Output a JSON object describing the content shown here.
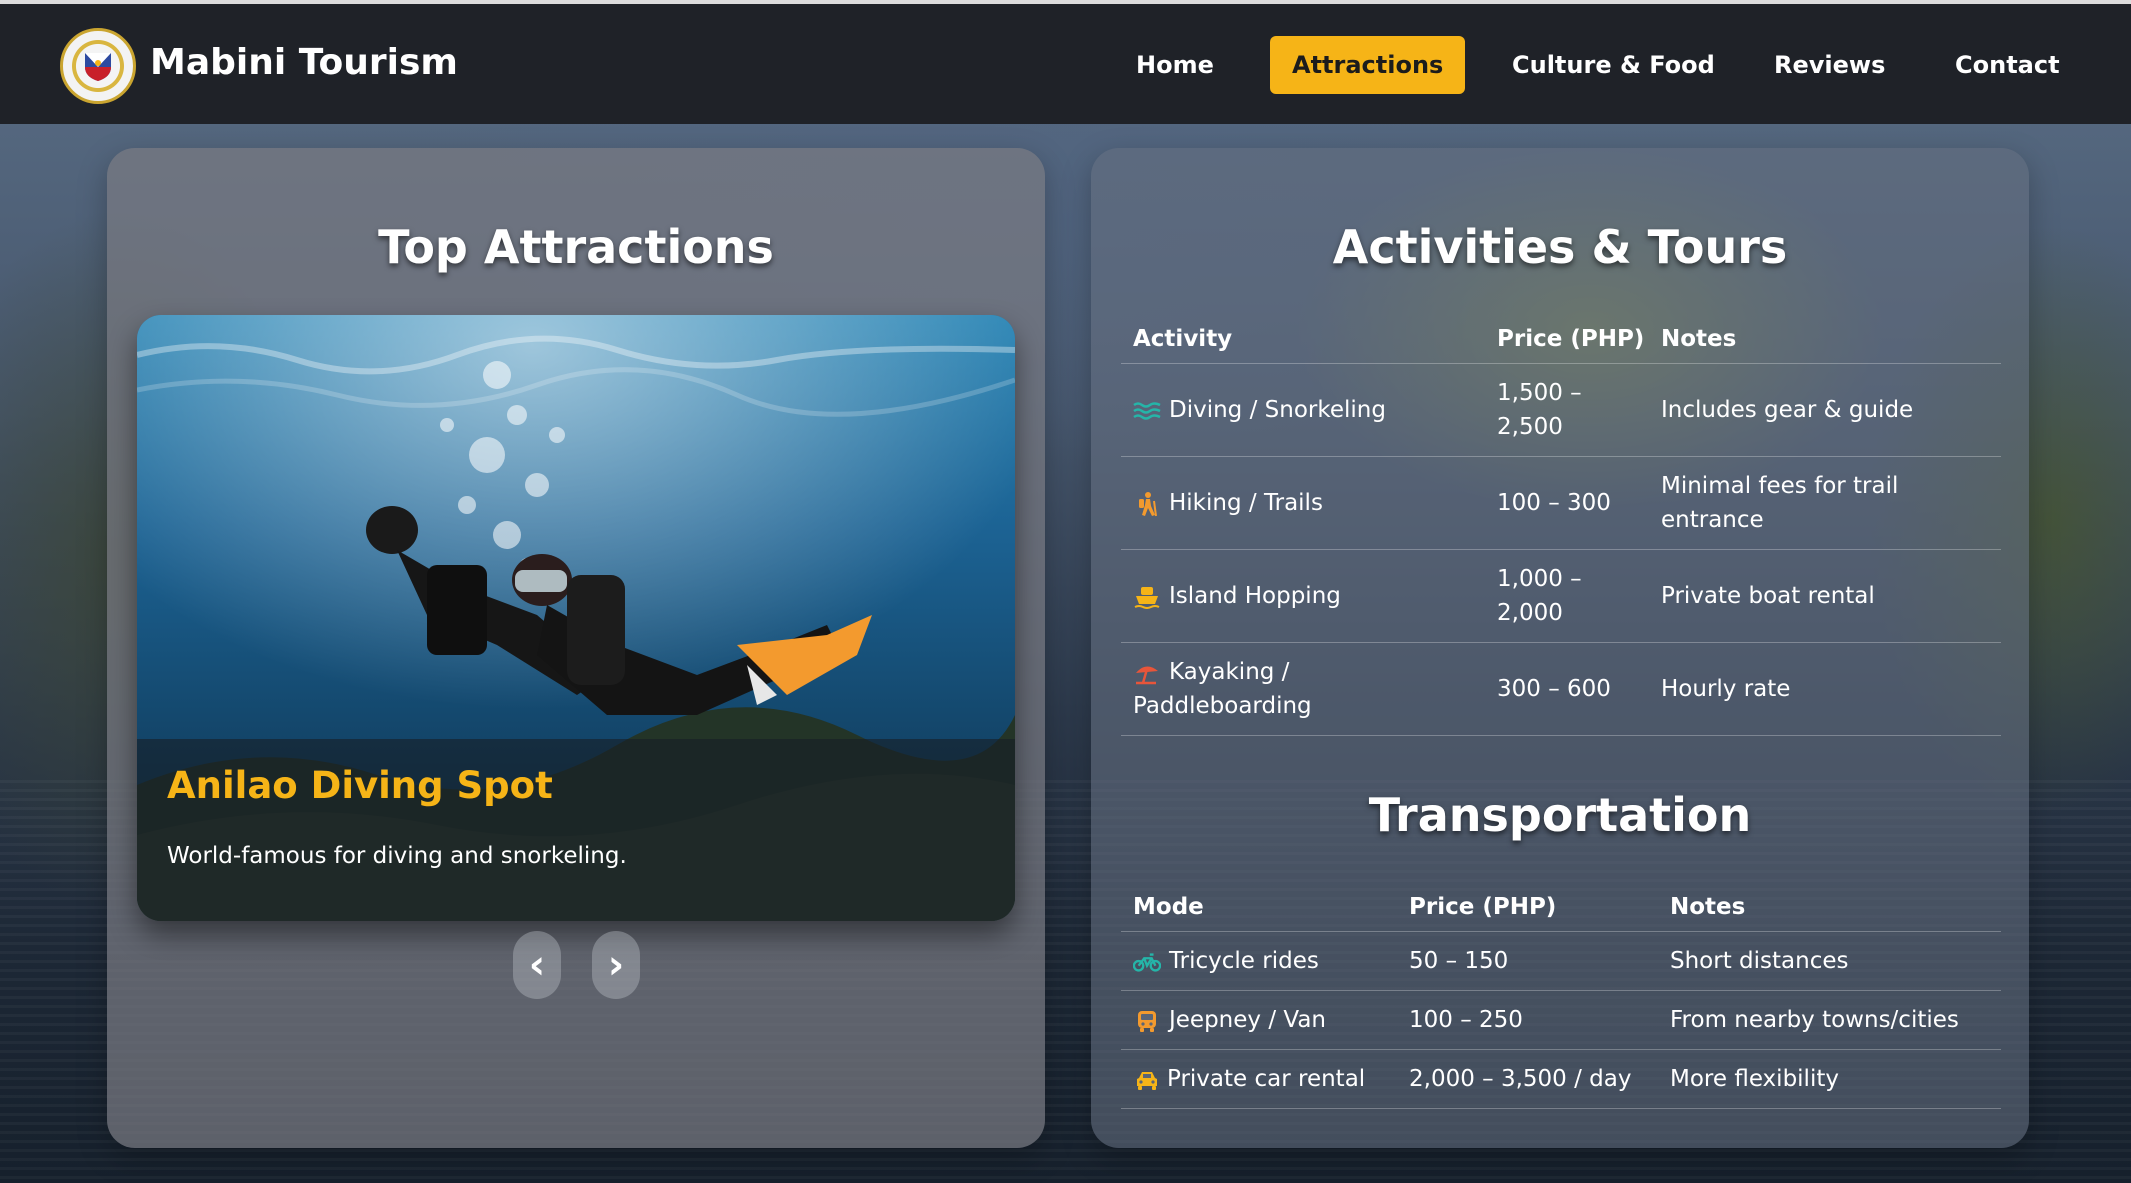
{
  "brand": {
    "name": "Mabini Tourism",
    "logo": "municipal-seal"
  },
  "nav": {
    "items": [
      {
        "label": "Home",
        "active": false
      },
      {
        "label": "Attractions",
        "active": true
      },
      {
        "label": "Culture & Food",
        "active": false
      },
      {
        "label": "Reviews",
        "active": false
      },
      {
        "label": "Contact",
        "active": false
      }
    ]
  },
  "colors": {
    "accent": "#f6b417",
    "navbar": "#1f2228",
    "icon_teal": "#25b5a8",
    "icon_orange": "#f39a2e",
    "icon_yellow": "#f6b417"
  },
  "attractions": {
    "title": "Top Attractions",
    "current": {
      "name": "Anilao Diving Spot",
      "description": "World-famous for diving and snorkeling."
    },
    "prev_label": "‹",
    "next_label": "›"
  },
  "activities": {
    "title": "Activities & Tours",
    "columns": [
      "Activity",
      "Price (PHP)",
      "Notes"
    ],
    "rows": [
      {
        "icon": "waves-icon",
        "activity": "Diving / Snorkeling",
        "price_line1": "1,500 –",
        "price_line2": "2,500",
        "notes_line1": "Includes gear & guide",
        "notes_line2": ""
      },
      {
        "icon": "hiking-icon",
        "activity": "Hiking / Trails",
        "price_line1": "100 – 300",
        "price_line2": "",
        "notes_line1": "Minimal fees for trail",
        "notes_line2": "entrance"
      },
      {
        "icon": "ship-icon",
        "activity": "Island Hopping",
        "price_line1": "1,000 –",
        "price_line2": "2,000",
        "notes_line1": "Private boat rental",
        "notes_line2": ""
      },
      {
        "icon": "beach-umbrella-icon",
        "activity_line1": "Kayaking /",
        "activity_line2": "Paddleboarding",
        "price_line1": "300 – 600",
        "price_line2": "",
        "notes_line1": "Hourly rate",
        "notes_line2": ""
      }
    ]
  },
  "transportation": {
    "title": "Transportation",
    "columns": [
      "Mode",
      "Price (PHP)",
      "Notes"
    ],
    "rows": [
      {
        "icon": "motorcycle-icon",
        "mode": "Tricycle rides",
        "price": "50 – 150",
        "notes": "Short distances"
      },
      {
        "icon": "bus-icon",
        "mode": "Jeepney / Van",
        "price": "100 – 250",
        "notes": "From nearby towns/cities"
      },
      {
        "icon": "car-icon",
        "mode": "Private car rental",
        "price": "2,000 – 3,500 / day",
        "notes": "More flexibility"
      }
    ]
  }
}
